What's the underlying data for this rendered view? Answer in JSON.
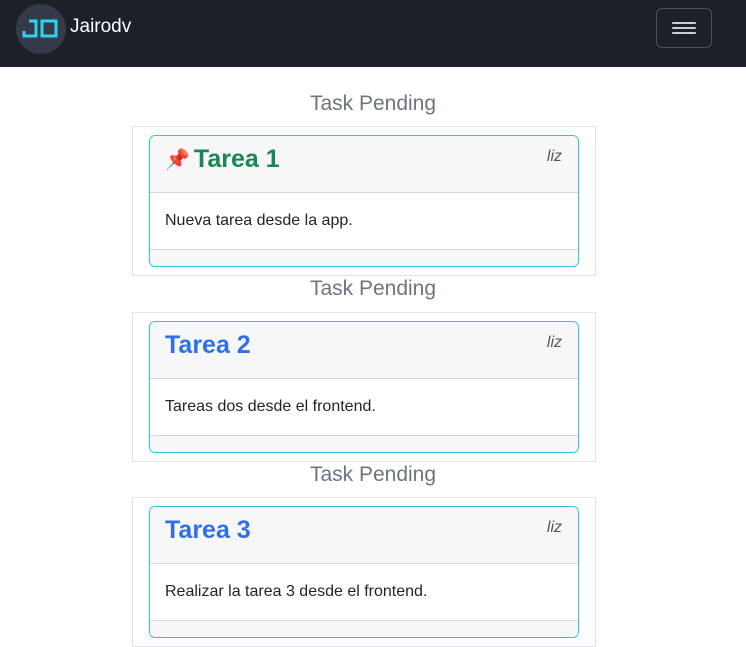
{
  "navbar": {
    "brand_name": "Jairodv",
    "logo_text": "JD",
    "logo_color": "#2fd3f0",
    "toggler_icon": "hamburger-menu-icon"
  },
  "sections": [
    {
      "heading": "Task Pending",
      "task": {
        "title": "Tarea 1",
        "title_color": "#198754",
        "pinned": true,
        "pin_icon": "📌",
        "author": "liz",
        "description": "Nueva tarea desde la app."
      }
    },
    {
      "heading": "Task Pending",
      "task": {
        "title": "Tarea 2",
        "title_color": "#2f6fe8",
        "pinned": false,
        "author": "liz",
        "description": "Tareas dos desde el frontend."
      }
    },
    {
      "heading": "Task Pending",
      "task": {
        "title": "Tarea 3",
        "title_color": "#2f6fe8",
        "pinned": false,
        "author": "liz",
        "description": "Realizar la tarea 3 desde el frontend."
      }
    }
  ]
}
